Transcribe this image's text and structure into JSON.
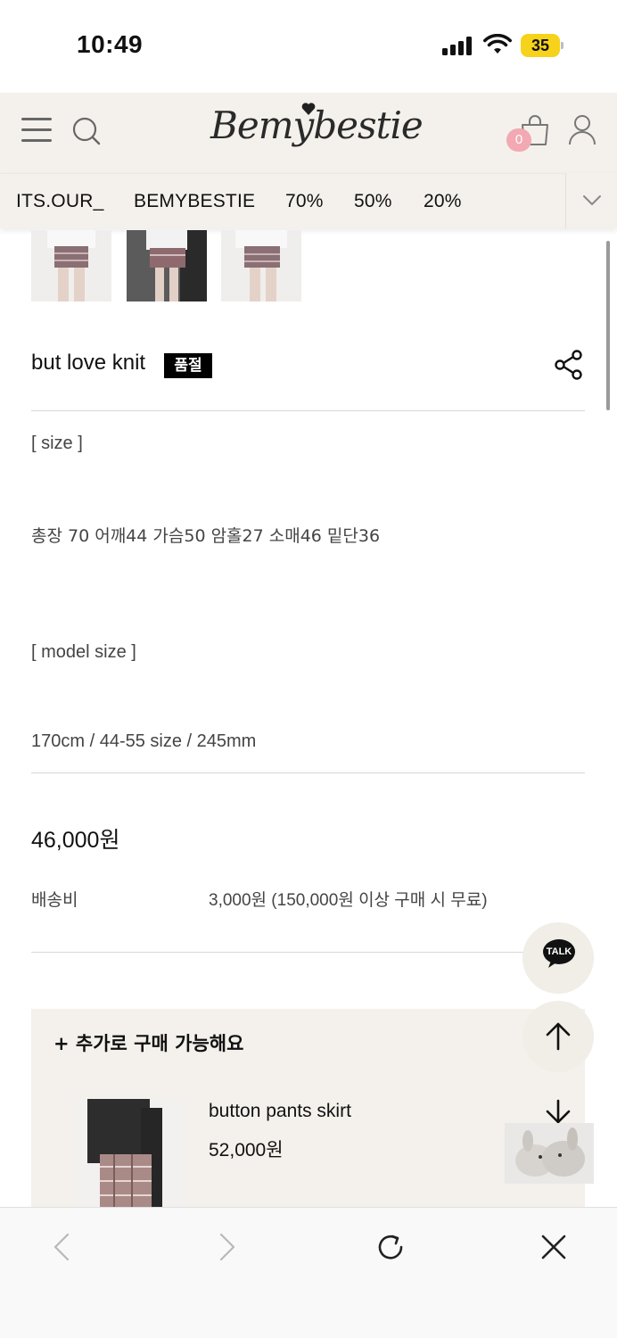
{
  "status_bar": {
    "time": "10:49",
    "battery": "35"
  },
  "header": {
    "logo": "Bemybestie",
    "cart_count": "0"
  },
  "category_nav": {
    "items": [
      "ITS.OUR_",
      "BEMYBESTIE",
      "70%",
      "50%",
      "20%"
    ]
  },
  "product": {
    "title": "but love knit",
    "badge": "품절",
    "size_heading": "[ size ]",
    "size_detail": "총장 70 어깨44 가슴50 암홀27 소매46 밑단36",
    "model_heading": "[ model size ]",
    "model_detail": "170cm / 44-55 size / 245mm",
    "price": "46,000원",
    "shipping_label": "배송비",
    "shipping_value": "3,000원 (150,000원 이상 구매 시 무료)"
  },
  "addon": {
    "title": "+ 추가로 구매 가능해요",
    "items": [
      {
        "name": "button pants skirt",
        "price": "52,000원"
      }
    ]
  },
  "floating": {
    "talk_label": "TALK"
  },
  "icons": {
    "menu": "hamburger-icon",
    "search": "search-icon",
    "cart": "shopping-bag-icon",
    "user": "user-icon",
    "share": "share-icon",
    "more": "chevron-down-icon",
    "up": "arrow-up-icon",
    "down": "arrow-down-icon",
    "back": "chevron-left-icon",
    "forward": "chevron-right-icon",
    "reload": "reload-icon",
    "close": "close-icon"
  },
  "colors": {
    "header_bg": "#f4f1ec",
    "badge_bg": "#000000",
    "cart_badge": "#f2a9b3",
    "battery": "#f7d21a"
  }
}
